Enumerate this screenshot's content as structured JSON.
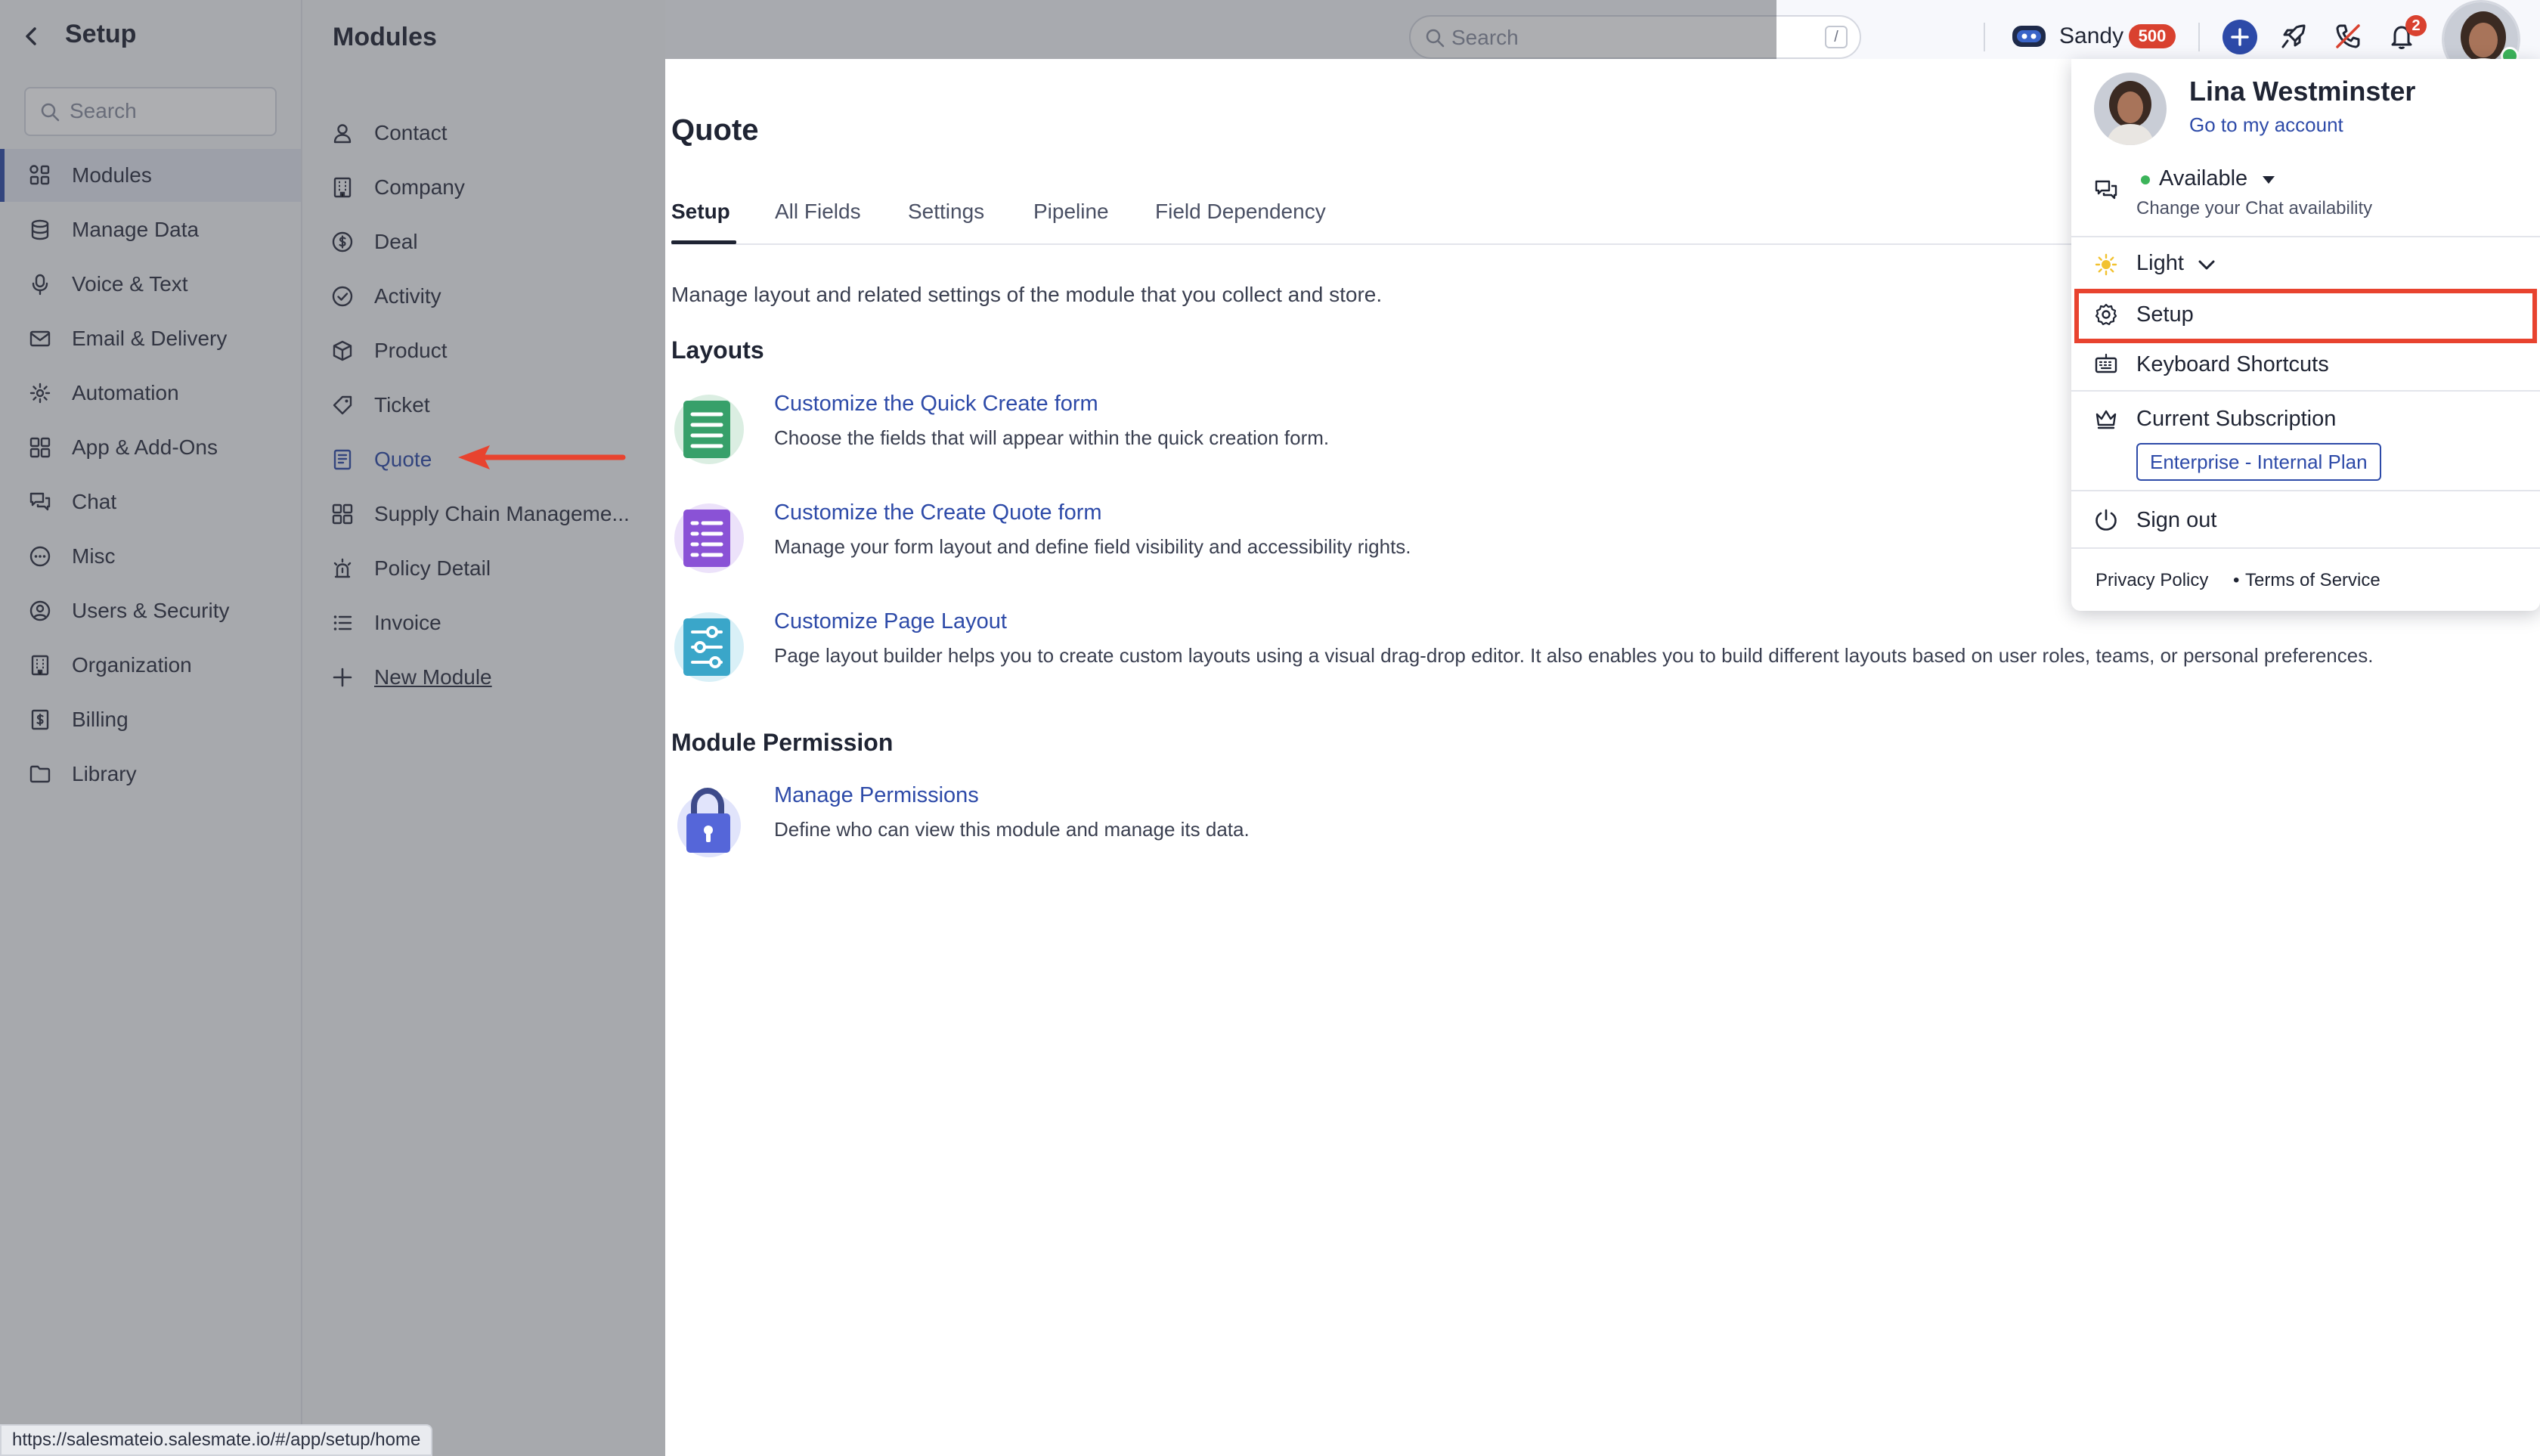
{
  "sidebar": {
    "title": "Setup",
    "search_placeholder": "Search",
    "items": [
      {
        "label": "Modules",
        "icon": "modules-icon",
        "active": true
      },
      {
        "label": "Manage Data",
        "icon": "database-icon"
      },
      {
        "label": "Voice & Text",
        "icon": "microphone-icon"
      },
      {
        "label": "Email & Delivery",
        "icon": "envelope-icon"
      },
      {
        "label": "Automation",
        "icon": "automation-icon"
      },
      {
        "label": "App & Add-Ons",
        "icon": "apps-grid-icon"
      },
      {
        "label": "Chat",
        "icon": "chat-icon"
      },
      {
        "label": "Misc",
        "icon": "more-circle-icon"
      },
      {
        "label": "Users & Security",
        "icon": "user-circle-icon"
      },
      {
        "label": "Organization",
        "icon": "building-icon"
      },
      {
        "label": "Billing",
        "icon": "billing-icon"
      },
      {
        "label": "Library",
        "icon": "folder-icon"
      }
    ]
  },
  "modules": {
    "title": "Modules",
    "items": [
      {
        "label": "Contact",
        "icon": "person-icon"
      },
      {
        "label": "Company",
        "icon": "building-icon"
      },
      {
        "label": "Deal",
        "icon": "dollar-circle-icon"
      },
      {
        "label": "Activity",
        "icon": "check-circle-icon"
      },
      {
        "label": "Product",
        "icon": "box-icon"
      },
      {
        "label": "Ticket",
        "icon": "tag-icon"
      },
      {
        "label": "Quote",
        "icon": "quote-doc-icon",
        "selected": true
      },
      {
        "label": "Supply Chain Manageme...",
        "icon": "grid-icon"
      },
      {
        "label": "Policy Detail",
        "icon": "policy-icon"
      },
      {
        "label": "Invoice",
        "icon": "list-icon"
      },
      {
        "label": "New Module",
        "icon": "plus-icon"
      }
    ]
  },
  "topbar": {
    "search_placeholder": "Search",
    "search_shortcut": "/",
    "user_short": "Sandy",
    "credits_badge": "500",
    "notification_count": "2"
  },
  "main": {
    "page_title": "Quote",
    "tabs": [
      "Setup",
      "All Fields",
      "Settings",
      "Pipeline",
      "Field Dependency"
    ],
    "active_tab": "Setup",
    "intro": "Manage layout and related settings of the module that you collect and store.",
    "layouts_heading": "Layouts",
    "layouts": [
      {
        "title": "Customize the Quick Create form",
        "desc": "Choose the fields that will appear within the quick creation form.",
        "icon": "quick-create-form-icon"
      },
      {
        "title": "Customize the Create Quote form",
        "desc": "Manage your form layout and define field visibility and accessibility rights.",
        "icon": "create-form-icon"
      },
      {
        "title": "Customize Page Layout",
        "desc": "Page layout builder helps you to create custom layouts using a visual drag-drop editor. It also enables you to build different layouts based on user roles, teams, or personal preferences.",
        "icon": "page-layout-icon"
      }
    ],
    "permission_heading": "Module Permission",
    "permission": {
      "title": "Manage Permissions",
      "desc": "Define who can view this module and manage its data.",
      "icon": "lock-icon"
    }
  },
  "profile_menu": {
    "name": "Lina Westminster",
    "account_link": "Go to my account",
    "availability": "Available",
    "availability_hint": "Change your Chat availability",
    "theme": "Light",
    "setup": "Setup",
    "shortcuts": "Keyboard Shortcuts",
    "subscription_label": "Current Subscription",
    "subscription_plan": "Enterprise - Internal Plan",
    "sign_out": "Sign out",
    "privacy": "Privacy Policy",
    "footer_sep": "•",
    "terms": "Terms of Service"
  },
  "status_bar": {
    "url": "https://salesmateio.salesmate.io/#/app/setup/home"
  },
  "colors": {
    "accent": "#2d4aa8",
    "annotation": "#e8432f",
    "online": "#3cb45a",
    "badge": "#d9412f"
  }
}
